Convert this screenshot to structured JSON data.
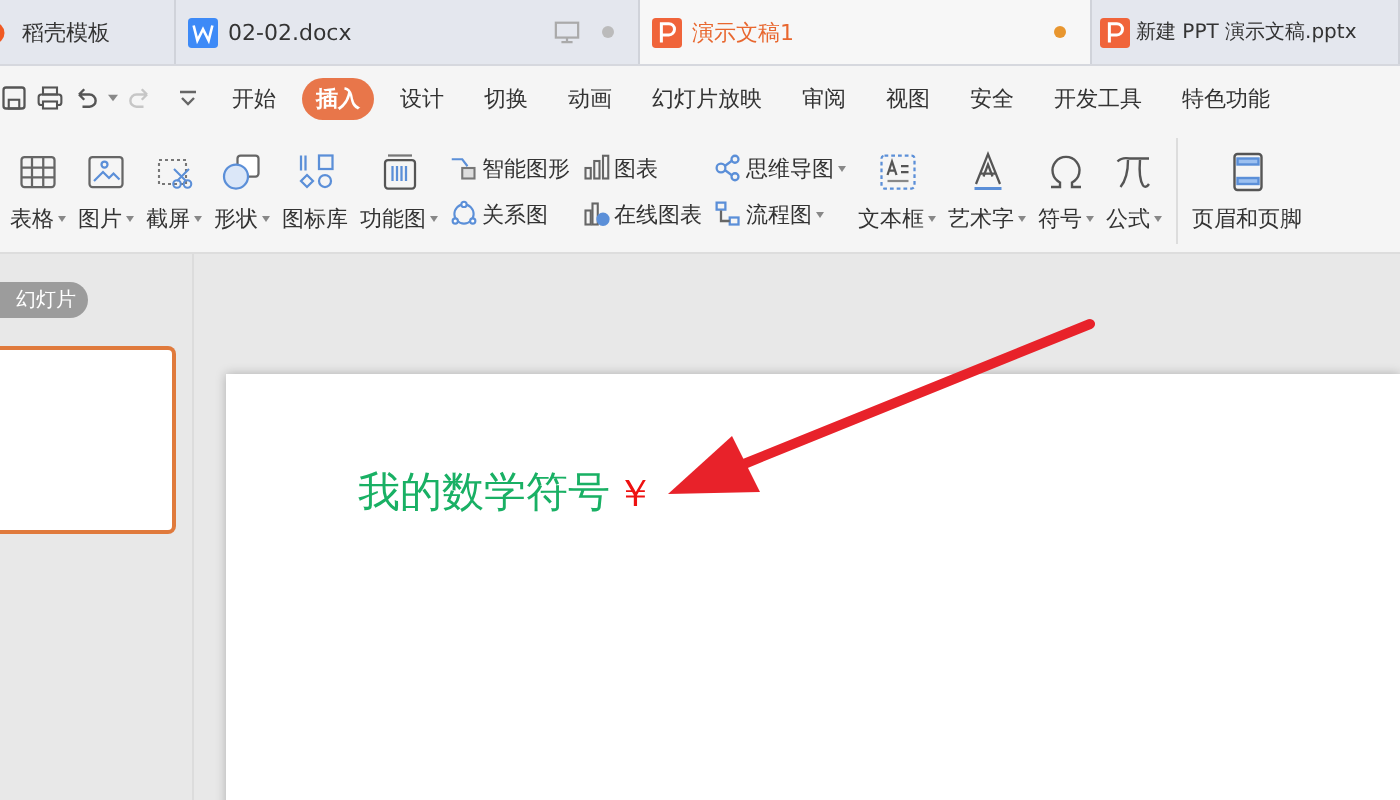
{
  "tabs": [
    {
      "label": "稻壳模板",
      "kind": "template",
      "selected": false,
      "dot": false,
      "monitor": false
    },
    {
      "label": "02-02.docx",
      "kind": "writer",
      "selected": false,
      "dot": true,
      "monitor": true
    },
    {
      "label": "演示文稿1",
      "kind": "presentation",
      "selected": true,
      "dot": true,
      "monitor": false
    },
    {
      "label": "新建 PPT 演示文稿.pptx",
      "kind": "presentation",
      "selected": false,
      "dot": false,
      "monitor": false
    }
  ],
  "menu": [
    {
      "label": "开始",
      "selected": false
    },
    {
      "label": "插入",
      "selected": true
    },
    {
      "label": "设计",
      "selected": false
    },
    {
      "label": "切换",
      "selected": false
    },
    {
      "label": "动画",
      "selected": false
    },
    {
      "label": "幻灯片放映",
      "selected": false
    },
    {
      "label": "审阅",
      "selected": false
    },
    {
      "label": "视图",
      "selected": false
    },
    {
      "label": "安全",
      "selected": false
    },
    {
      "label": "开发工具",
      "selected": false
    },
    {
      "label": "特色功能",
      "selected": false
    }
  ],
  "ribbon": [
    {
      "kind": "large",
      "label": "表格",
      "dropdown": true
    },
    {
      "kind": "large",
      "label": "图片",
      "dropdown": true
    },
    {
      "kind": "large",
      "label": "截屏",
      "dropdown": true
    },
    {
      "kind": "large",
      "label": "形状",
      "dropdown": true
    },
    {
      "kind": "large",
      "label": "图标库",
      "dropdown": false
    },
    {
      "kind": "large",
      "label": "功能图",
      "dropdown": true
    },
    {
      "kind": "pair",
      "items": [
        {
          "label": "智能图形",
          "dropdown": false
        },
        {
          "label": "关系图",
          "dropdown": false
        }
      ]
    },
    {
      "kind": "pair",
      "items": [
        {
          "label": "图表",
          "dropdown": false
        },
        {
          "label": "在线图表",
          "dropdown": false
        }
      ]
    },
    {
      "kind": "pair",
      "items": [
        {
          "label": "思维导图",
          "dropdown": true
        },
        {
          "label": "流程图",
          "dropdown": true
        }
      ]
    },
    {
      "kind": "large",
      "label": "文本框",
      "dropdown": true
    },
    {
      "kind": "large",
      "label": "艺术字",
      "dropdown": true
    },
    {
      "kind": "large",
      "label": "符号",
      "dropdown": true
    },
    {
      "kind": "large",
      "label": "公式",
      "dropdown": true
    },
    {
      "kind": "separator"
    },
    {
      "kind": "large",
      "label": "页眉和页脚",
      "dropdown": false
    }
  ],
  "slide_panel": {
    "label": "幻灯片",
    "thumbnails": [
      {
        "selected": true
      }
    ]
  },
  "slide": {
    "text": "我的数学符号",
    "symbol": "￥"
  }
}
